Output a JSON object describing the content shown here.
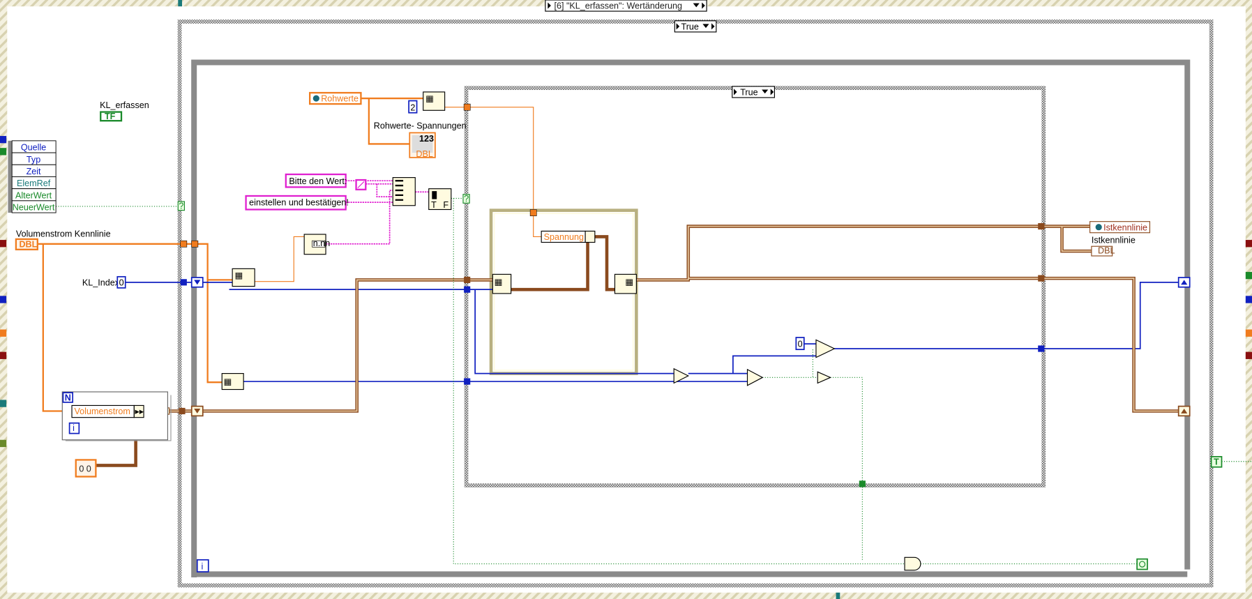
{
  "event_structure": {
    "selector": "[6] \"KL_erfassen\": Wertänderung"
  },
  "outer_case": {
    "selector": "True"
  },
  "inner_case": {
    "selector": "True"
  },
  "event_data_node": {
    "items": [
      "Quelle",
      "Typ",
      "Zeit",
      "ElemRef",
      "AlterWert",
      "NeuerWert"
    ]
  },
  "controls": {
    "kl_erfassen": {
      "label": "KL_erfassen",
      "terminal": "TF"
    },
    "volumenstrom_kennlinie": {
      "label": "Volumenstrom Kennlinie",
      "terminal": "DBL"
    },
    "kl_index": {
      "label": "KL_Index",
      "value": "0"
    },
    "rohwerte_property": "Rohwerte",
    "rohwerte_spannungen": {
      "label": "Rohwerte- Spannungen",
      "terminal": "DBL",
      "display": "123"
    },
    "istkennlinie_property": "Istkennlinie",
    "istkennlinie": {
      "label": "Istkennlinie",
      "terminal": "DBL"
    }
  },
  "constants": {
    "index_2": "2",
    "bitte": "Bitte den Wert:",
    "einstellen": "einstellen und bestätigen!",
    "zero": "0",
    "array_const": "0 0",
    "dialog_t": "T",
    "dialog_f": "F",
    "format_text": "n.nn"
  },
  "unbundle": {
    "volumenstrom": "Volumenstrom",
    "spannung": "Spannung"
  },
  "loop_terminals": {
    "n": "N",
    "i": "i",
    "unknown": "?",
    "true_terminal": "T"
  },
  "colors": {
    "orange": "#f07c1e",
    "blue": "#1020c0",
    "brown": "#8a4a1e",
    "pink": "#e020d0",
    "green": "#1a8a2a"
  }
}
